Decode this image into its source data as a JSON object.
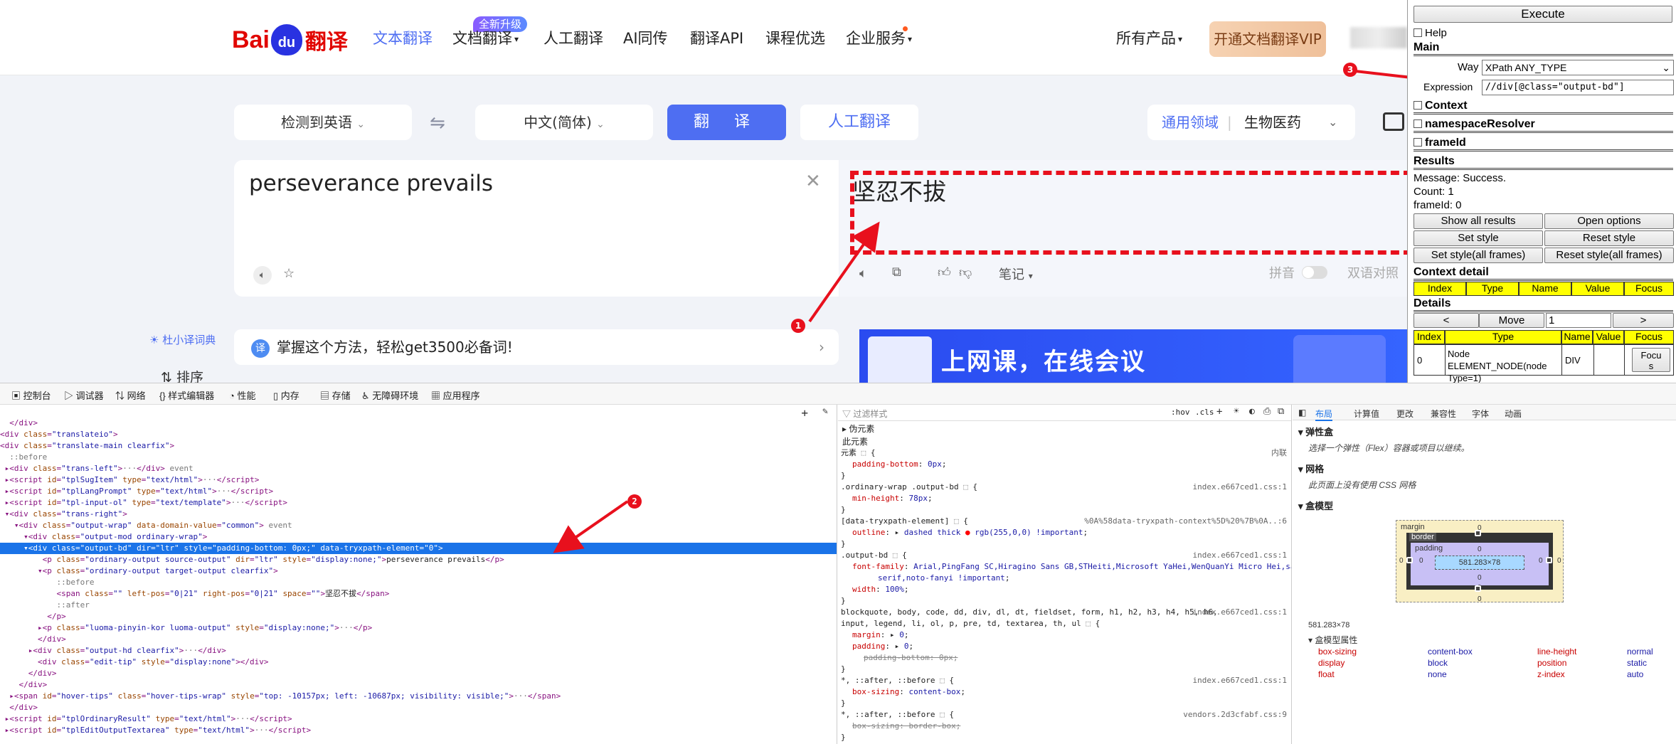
{
  "baidu": {
    "logo": {
      "bai": "Bai",
      "du": "du",
      "fanyi": "翻译"
    },
    "nav": [
      {
        "label": "文本翻译",
        "active": true
      },
      {
        "label": "文档翻译",
        "dropdown": true
      },
      {
        "label": "人工翻译"
      },
      {
        "label": "AI同传"
      },
      {
        "label": "翻译API"
      },
      {
        "label": "课程优选"
      },
      {
        "label": "企业服务",
        "dropdown": true
      }
    ],
    "new_badge": "全新升级",
    "all_products": "所有产品",
    "vip_button": "开通文档翻译VIP",
    "source_lang": "检测到英语",
    "target_lang": "中文(简体)",
    "translate_button": "翻 译",
    "human_button": "人工翻译",
    "domain_label": "通用领域",
    "domain_value": "生物医药",
    "source_text": "perseverance prevails",
    "target_text": "坚忍不拔",
    "notes_label": "笔记",
    "pinyin_label": "拼音",
    "bilingual_label": "双语对照",
    "dict_link": "杜小译词典",
    "tip_text": "掌握这个方法，轻松get3500必备词!",
    "tip_tag": "译",
    "banner_text": "上网课，在线会议",
    "sort_button": "排序",
    "annotations": [
      "1",
      "2",
      "3"
    ]
  },
  "xpath_panel": {
    "execute": "Execute",
    "help": "Help",
    "main_label": "Main",
    "way_label": "Way",
    "way_value": "XPath ANY_TYPE",
    "expression_label": "Expression",
    "expression_value": "//div[@class=\"output-bd\"]",
    "context_label": "Context",
    "namespace_label": "namespaceResolver",
    "frameid_label": "frameId",
    "results_label": "Results",
    "message": "Message: Success.",
    "count": "Count: 1",
    "frameid_value": "frameId: 0",
    "buttons": [
      "Show all results",
      "Open options",
      "Set style",
      "Reset style",
      "Set style(all frames)",
      "Reset style(all frames)"
    ],
    "context_detail_label": "Context detail",
    "context_headers": [
      "Index",
      "Type",
      "Name",
      "Value",
      "Focus"
    ],
    "details_label": "Details",
    "nav_prev": "<",
    "nav_move": "Move",
    "nav_input": "1",
    "nav_next": ">",
    "detail_headers": [
      "Index",
      "Type",
      "Name",
      "Value",
      "Focus"
    ],
    "detail_row": {
      "index": "0",
      "type_line1": "Node ELEMENT_NODE(node",
      "type_line2": "Type=1)",
      "name": "DIV",
      "value": "",
      "focus_line1": "Focu",
      "focus_line2": "s"
    }
  },
  "devtools": {
    "tabs": [
      "控制台",
      "调试器",
      "网络",
      "样式编辑器",
      "性能",
      "内存",
      "存储",
      "无障碍环境",
      "应用程序"
    ],
    "styles_filter": "过滤样式",
    "styles_toggles": [
      ":hov",
      ".cls"
    ],
    "layout_tabs": [
      "布局",
      "计算值",
      "更改",
      "兼容性",
      "字体",
      "动画"
    ],
    "pseudo_label": "伪元素",
    "this_element": "此元素",
    "inline_label": "内联",
    "flex_label": "弹性盒",
    "flex_note": "选择一个弹性（Flex）容器或项目以继续。",
    "grid_label": "网格",
    "grid_note": "此页面上没有使用 CSS 网格",
    "boxmodel_label": "盒模型",
    "box_size": "581.283×78",
    "bm_labels": {
      "margin": "margin",
      "border": "border",
      "padding": "padding"
    },
    "bm_props_label": "盒模型属性",
    "bm_props": [
      [
        "box-sizing",
        "content-box"
      ],
      [
        "display",
        "block"
      ],
      [
        "float",
        "none"
      ],
      [
        "line-height",
        "normal"
      ],
      [
        "position",
        "static"
      ],
      [
        "z-index",
        "auto"
      ]
    ]
  }
}
